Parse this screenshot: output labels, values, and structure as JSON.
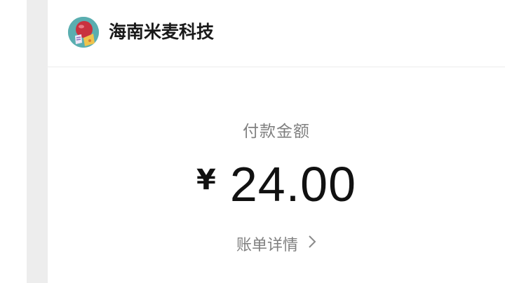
{
  "merchant": {
    "name": "海南米麦科技",
    "avatar_icon": "merchant-logo-icon"
  },
  "payment": {
    "label": "付款金额",
    "currency": "¥",
    "amount": "24.00"
  },
  "details": {
    "label": "账单详情",
    "icon": "chevron-right-icon"
  },
  "colors": {
    "gutter": "#ededed",
    "text_primary": "#111111",
    "text_secondary": "#808080",
    "avatar_bg": "#4fa7a7"
  }
}
